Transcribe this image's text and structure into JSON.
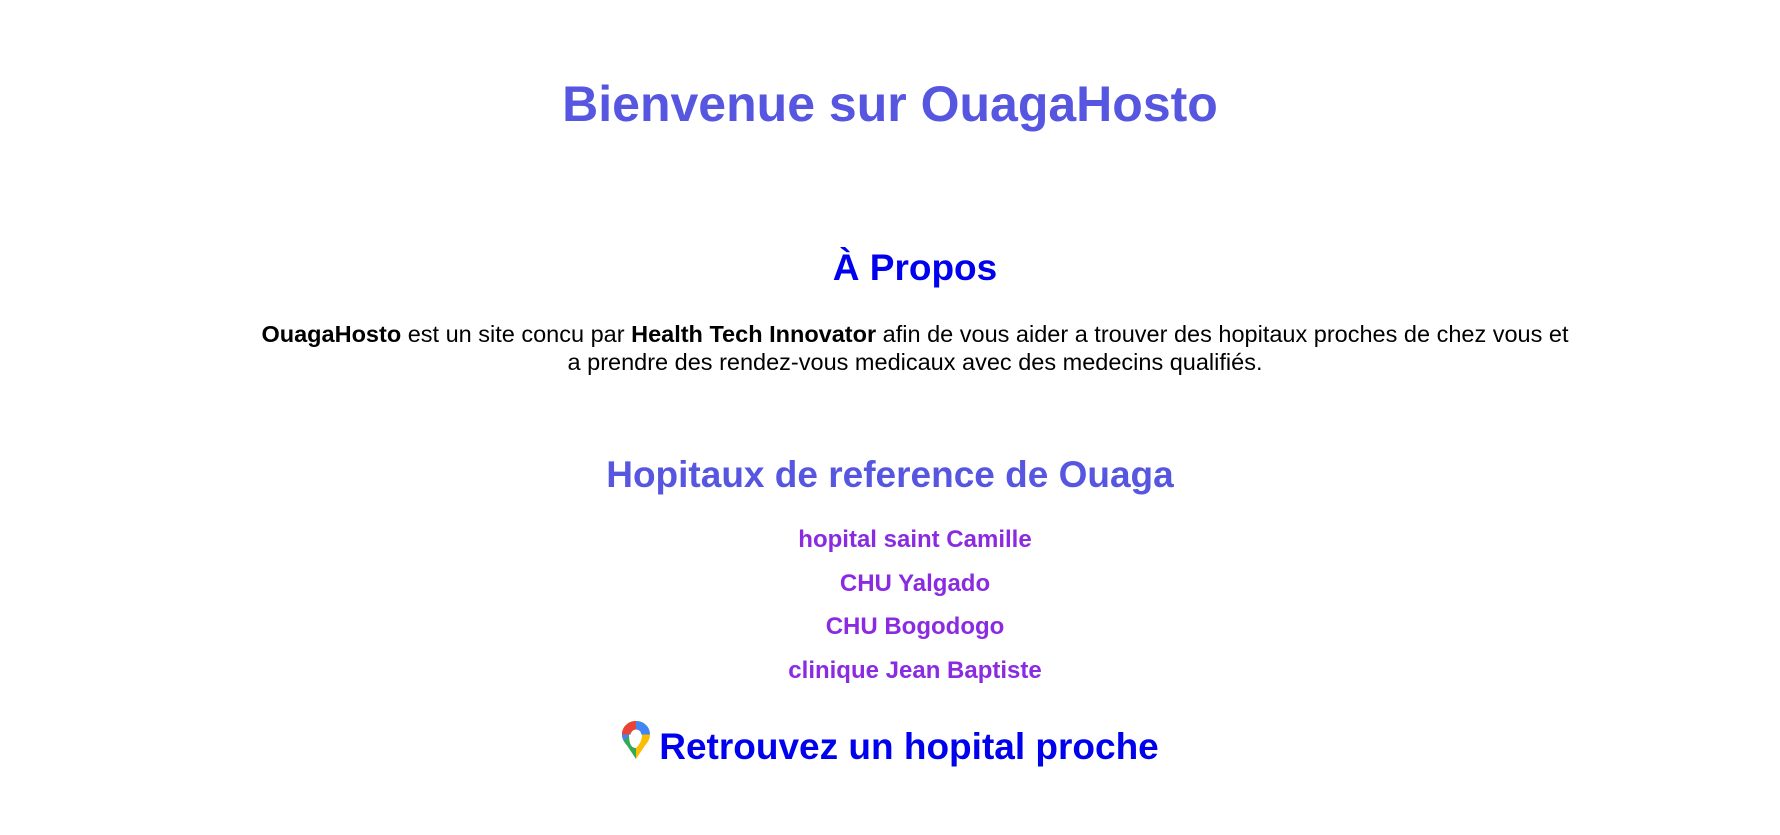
{
  "header": {
    "title": "Bienvenue sur OuagaHosto"
  },
  "about": {
    "title": "À Propos",
    "brand": "OuagaHosto",
    "text_1": " est un site concu par ",
    "company": "Health Tech Innovator",
    "text_2": " afin de vous aider a trouver des hopitaux proches de chez vous et a prendre des rendez-vous medicaux avec des medecins qualifiés."
  },
  "hospitals": {
    "title": "Hopitaux de reference de Ouaga",
    "items": [
      {
        "label": "hopital saint Camille"
      },
      {
        "label": "CHU Yalgado"
      },
      {
        "label": "CHU Bogodogo"
      },
      {
        "label": "clinique Jean Baptiste"
      }
    ]
  },
  "find": {
    "icon": "map-pin-icon",
    "label": "Retrouvez un hopital proche"
  },
  "colors": {
    "title": "#5656e0",
    "link": "#0000ee",
    "hospital_link": "#8a2be2",
    "text": "#000000"
  }
}
